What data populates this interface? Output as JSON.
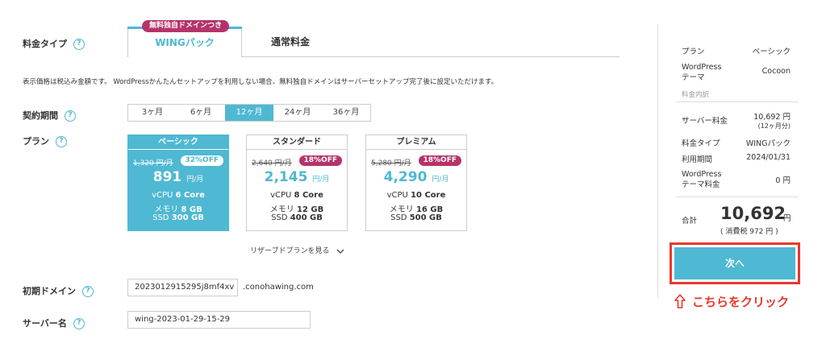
{
  "labels": {
    "plan_type": "料金タイプ",
    "period": "契約期間",
    "plan": "プラン",
    "initial_domain": "初期ドメイン",
    "server_name": "サーバー名"
  },
  "tabs": {
    "badge": "無料独自ドメインつき",
    "wing": "WINGパック",
    "normal": "通常料金"
  },
  "note": "表示価格は税込み金額です。 WordPressかんたんセットアップを利用しない場合、無料独自ドメインはサーバーセットアップ完了後に設定いただけます。",
  "periods": [
    "3ヶ月",
    "6ヶ月",
    "12ヶ月",
    "24ヶ月",
    "36ヶ月"
  ],
  "plans": [
    {
      "name": "ベーシック",
      "old": "1,320 円/月",
      "off": "32%OFF",
      "price": "891",
      "unit": "円/月",
      "cpu": "6 Core",
      "mem": "8 GB",
      "ssd": "300 GB"
    },
    {
      "name": "スタンダード",
      "old": "2,640 円/月",
      "off": "18%OFF",
      "price": "2,145",
      "unit": "円/月",
      "cpu": "8 Core",
      "mem": "12 GB",
      "ssd": "400 GB"
    },
    {
      "name": "プレミアム",
      "old": "5,280 円/月",
      "off": "18%OFF",
      "price": "4,290",
      "unit": "円/月",
      "cpu": "10 Core",
      "mem": "16 GB",
      "ssd": "500 GB"
    }
  ],
  "spec_labels": {
    "cpu": "vCPU",
    "mem": "メモリ",
    "ssd": "SSD"
  },
  "reserve_link": "リザーブドプランを見る",
  "domain": {
    "value": "2023012915295j8mf4xv",
    "suffix": ".conohawing.com"
  },
  "server_name": {
    "value": "wing-2023-01-29-15-29"
  },
  "summary": {
    "plan_label": "プラン",
    "plan_value": "ベーシック",
    "theme_label": "WordPress\nテーマ",
    "theme_value": "Cocoon",
    "breakdown": "料金内訳",
    "server_fee_label": "サーバー料金",
    "server_fee_value": "10,692 円",
    "server_fee_sub": "(12ヶ月分)",
    "type_label": "料金タイプ",
    "type_value": "WINGパック",
    "period_label": "利用期間",
    "period_value": "2024/01/31",
    "theme_fee_label": "WordPress\nテーマ料金",
    "theme_fee_value": "0 円",
    "total_label": "合計",
    "total_value": "10,692",
    "total_unit": "円",
    "tax": "( 消費税 972 円 )"
  },
  "next_button": "次へ",
  "click_note": "こちらをクリック",
  "colors": {
    "accent": "#4fb8d3",
    "badge": "#b5336b",
    "highlight": "#e8382c"
  }
}
